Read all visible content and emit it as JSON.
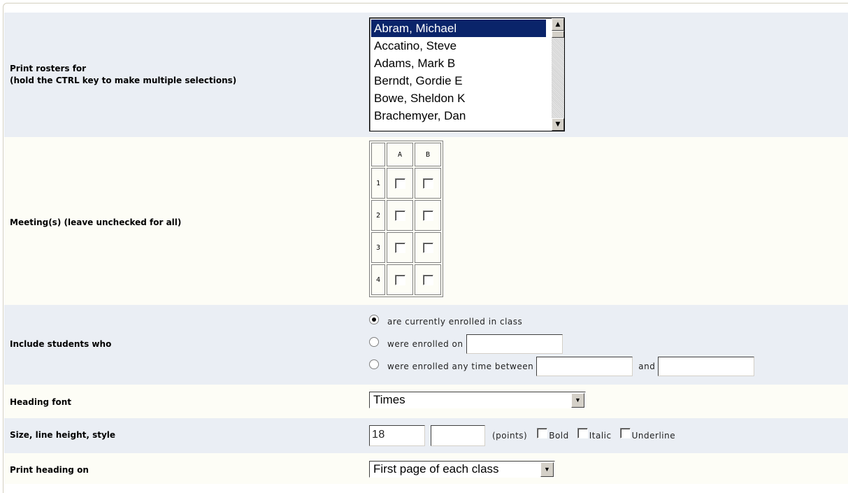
{
  "roster": {
    "label_line1": "Print rosters for",
    "label_line2": "(hold the CTRL key to make multiple selections)",
    "items": [
      "Abram, Michael",
      "Accatino, Steve",
      "Adams, Mark B",
      "Berndt, Gordie E",
      "Bowe, Sheldon K",
      "Brachemyer, Dan"
    ],
    "selected": "Abram, Michael"
  },
  "meetings": {
    "label": "Meeting(s) (leave unchecked for all)",
    "columns": [
      "A",
      "B"
    ],
    "rows": [
      "1",
      "2",
      "3",
      "4"
    ]
  },
  "include": {
    "label": "Include students who",
    "opt1": "are currently enrolled in class",
    "opt2": "were enrolled on",
    "opt3": "were enrolled any time between",
    "and": "and",
    "selected": "opt1"
  },
  "heading_font": {
    "label": "Heading font",
    "value": "Times"
  },
  "size_style": {
    "label": "Size, line height, style",
    "size_value": "18",
    "line_height_value": "",
    "points": "(points)",
    "bold": "Bold",
    "italic": "Italic",
    "underline": "Underline"
  },
  "print_heading": {
    "label": "Print heading on",
    "value": "First page of each class"
  }
}
